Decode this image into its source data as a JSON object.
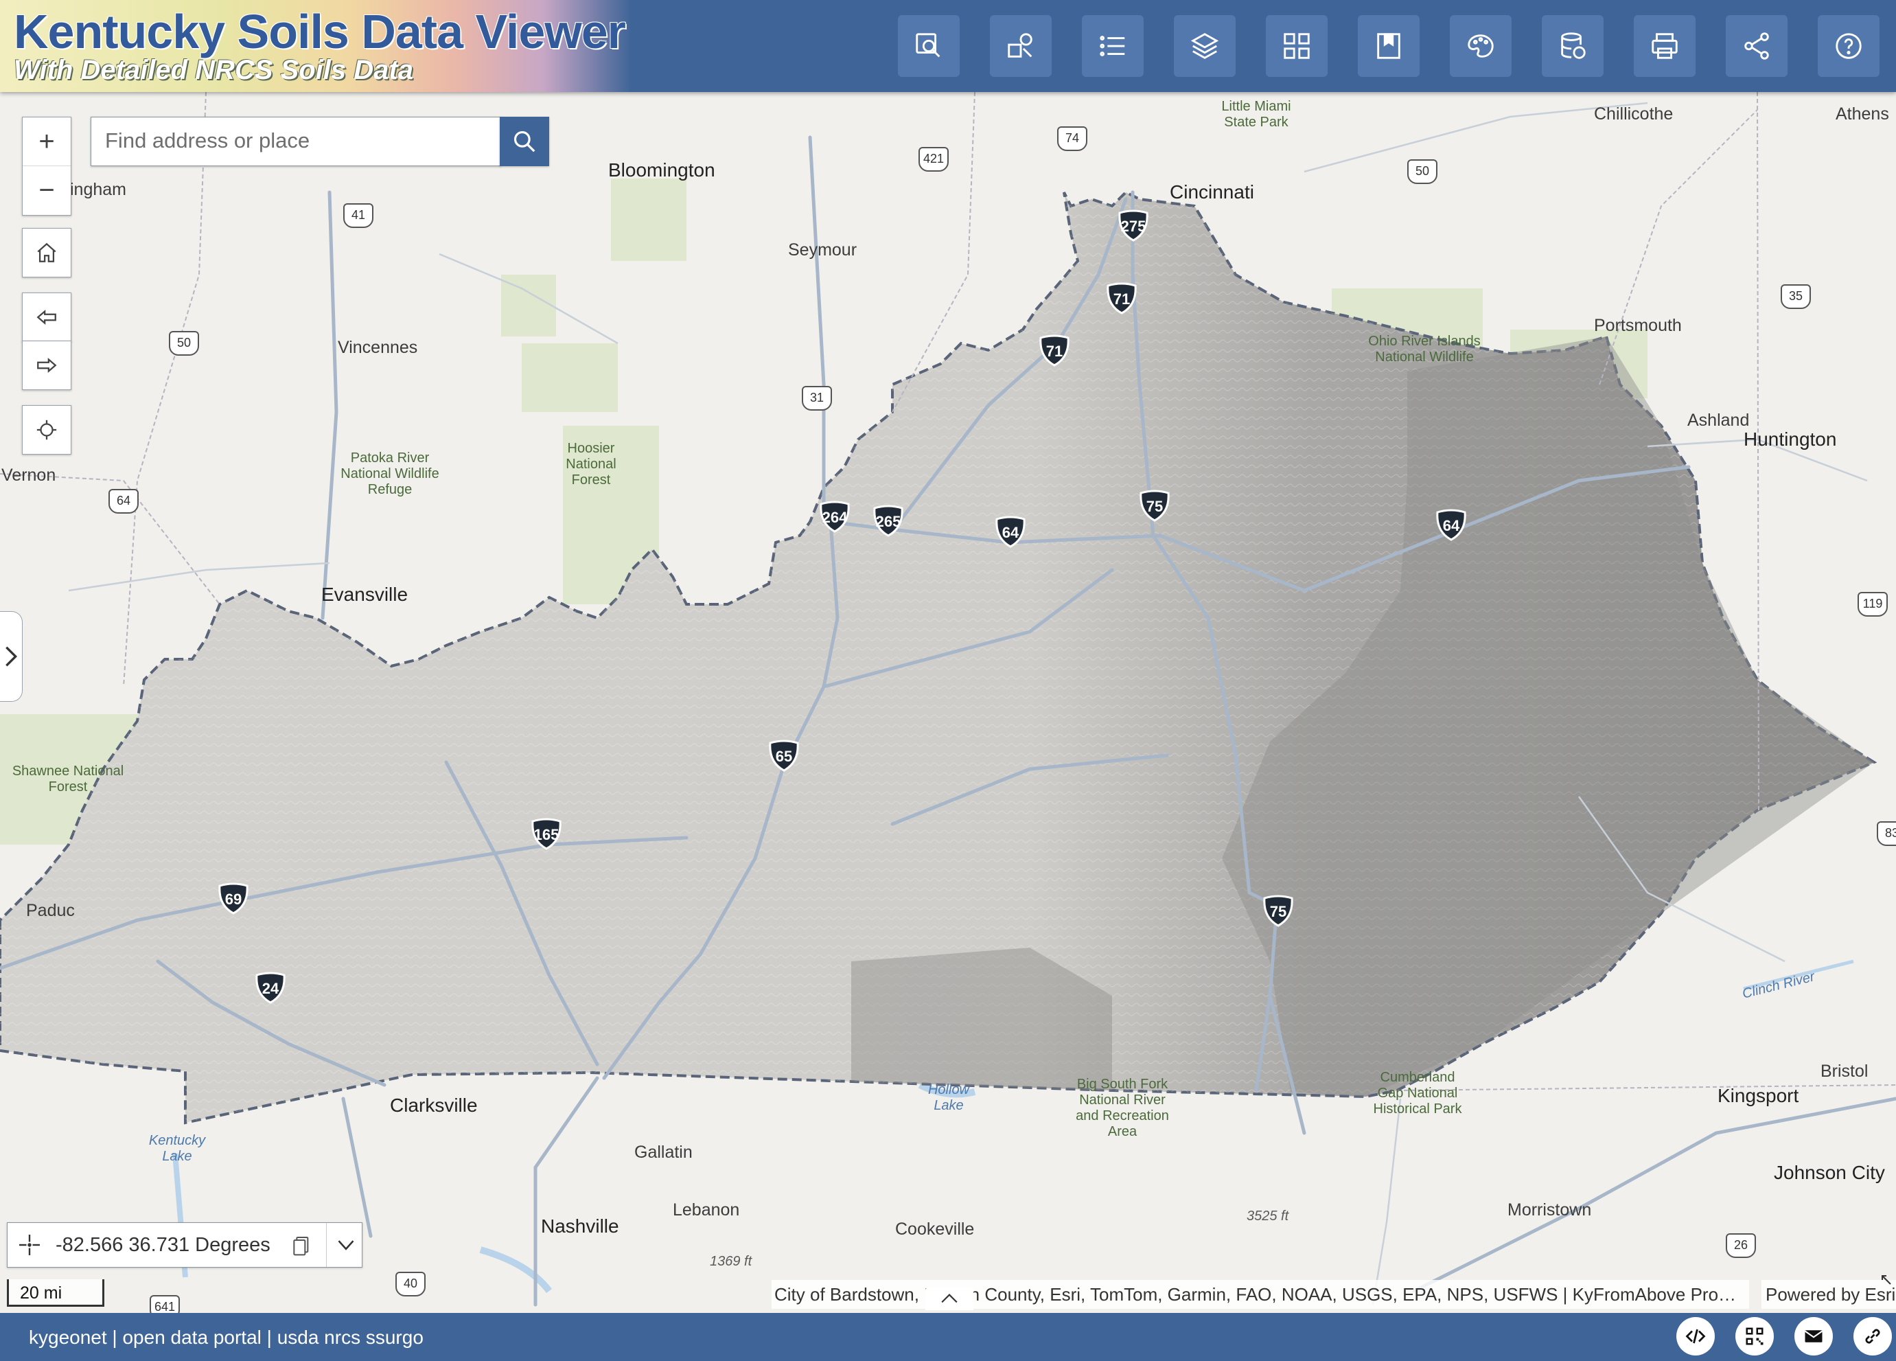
{
  "app": {
    "title": "Kentucky Soils Data Viewer",
    "subtitle": "With Detailed NRCS Soils Data"
  },
  "toolbar": [
    {
      "name": "identify",
      "icon": "magnify-map-icon"
    },
    {
      "name": "query",
      "icon": "shapes-select-icon"
    },
    {
      "name": "legend",
      "icon": "list-icon"
    },
    {
      "name": "layers",
      "icon": "layers-icon"
    },
    {
      "name": "basemaps",
      "icon": "grid-icon"
    },
    {
      "name": "bookmarks",
      "icon": "bookmark-icon"
    },
    {
      "name": "draw",
      "icon": "palette-icon"
    },
    {
      "name": "data",
      "icon": "database-icon"
    },
    {
      "name": "print",
      "icon": "printer-icon"
    },
    {
      "name": "share",
      "icon": "share-icon"
    },
    {
      "name": "help",
      "icon": "help-icon"
    }
  ],
  "search": {
    "placeholder": "Find address or place"
  },
  "zoom": {
    "in": "+",
    "out": "−"
  },
  "coordinates": {
    "value": "-82.566 36.731 Degrees"
  },
  "scale": {
    "label": "20 mi"
  },
  "attribution": {
    "text": "City of Bardstown, Nelson County, Esri, TomTom, Garmin, FAO, NOAA, USGS, EPA, NPS, USFWS | KyFromAbove Pro…",
    "powered": "Powered by Esri"
  },
  "footer": {
    "text": "kygeonet | open data portal | usda nrcs ssurgo"
  },
  "map": {
    "places": [
      {
        "name": "Bloomington"
      },
      {
        "name": "Seymour"
      },
      {
        "name": "Cincinnati"
      },
      {
        "name": "Little Miami State Park"
      },
      {
        "name": "Chillicothe"
      },
      {
        "name": "Athens"
      },
      {
        "name": "Portsmouth"
      },
      {
        "name": "Ashland"
      },
      {
        "name": "Huntington"
      },
      {
        "name": "Vincennes"
      },
      {
        "name": "Evansville"
      },
      {
        "name": "Vernon"
      },
      {
        "name": "ingham"
      },
      {
        "name": "Paduc"
      },
      {
        "name": "Clarksville"
      },
      {
        "name": "Gallatin"
      },
      {
        "name": "Lebanon"
      },
      {
        "name": "Nashville"
      },
      {
        "name": "Cookeville"
      },
      {
        "name": "Morristown"
      },
      {
        "name": "Kingsport"
      },
      {
        "name": "Johnson City"
      },
      {
        "name": "Bristol"
      }
    ],
    "parks": [
      {
        "name": "Patoka River National Wildlife Refuge"
      },
      {
        "name": "Hoosier National Forest"
      },
      {
        "name": "Shawnee National Forest"
      },
      {
        "name": "Ohio River Islands National Wildlife"
      },
      {
        "name": "Big South Fork National River and Recreation Area"
      },
      {
        "name": "Cumberland Gap National Historical Park"
      }
    ],
    "water": [
      {
        "name": "Hollow Lake"
      },
      {
        "name": "Kentucky Lake"
      },
      {
        "name": "Clinch River"
      }
    ],
    "elevations": [
      {
        "name": "1369 ft"
      },
      {
        "name": "3525 ft"
      }
    ],
    "interstates": [
      "275",
      "71",
      "71",
      "75",
      "264",
      "265",
      "64",
      "64",
      "65",
      "165",
      "69",
      "24",
      "75"
    ],
    "us_routes": [
      "421",
      "74",
      "50",
      "41",
      "50",
      "31",
      "64",
      "35",
      "119",
      "26",
      "40",
      "641",
      "83"
    ]
  },
  "colors": {
    "header": "#3f6497",
    "state_fill": "#cfcdc8",
    "boundary": "#5a6478"
  }
}
